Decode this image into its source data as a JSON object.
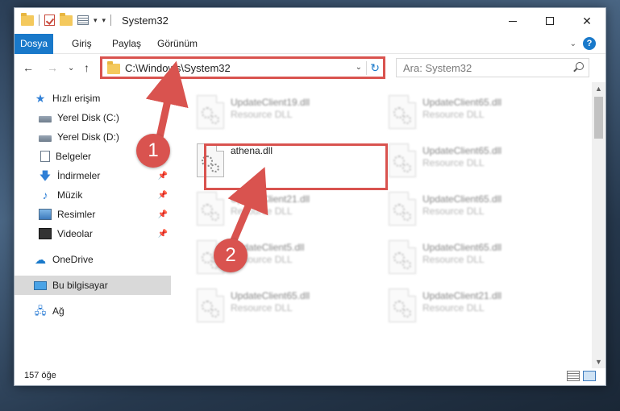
{
  "window": {
    "title": "System32"
  },
  "ribbon": {
    "tabs": [
      "Dosya",
      "Giriş",
      "Paylaş",
      "Görünüm"
    ]
  },
  "address": {
    "path": "C:\\Windows\\System32",
    "search_placeholder": "Ara: System32"
  },
  "sidebar": {
    "items": [
      {
        "label": "Hızlı erişim",
        "icon": "star-icon"
      },
      {
        "label": "Yerel Disk (C:)",
        "icon": "drive-icon"
      },
      {
        "label": "Yerel Disk (D:)",
        "icon": "drive-icon"
      },
      {
        "label": "Belgeler",
        "icon": "documents-icon"
      },
      {
        "label": "İndirmeler",
        "icon": "downloads-icon"
      },
      {
        "label": "Müzik",
        "icon": "music-icon"
      },
      {
        "label": "Resimler",
        "icon": "pictures-icon"
      },
      {
        "label": "Videolar",
        "icon": "videos-icon"
      },
      {
        "label": "OneDrive",
        "icon": "cloud-icon"
      },
      {
        "label": "Bu bilgisayar",
        "icon": "computer-icon"
      },
      {
        "label": "Ağ",
        "icon": "network-icon"
      }
    ]
  },
  "files": {
    "type_label": "Resource DLL",
    "items": [
      {
        "name": "UpdateClient19.dll",
        "blurred": true
      },
      {
        "name": "UpdateClient65.dll",
        "blurred": true
      },
      {
        "name": "athena.dll",
        "blurred": false
      },
      {
        "name": "UpdateClient65.dll",
        "blurred": true
      },
      {
        "name": "UpdateClient21.dll",
        "blurred": true
      },
      {
        "name": "UpdateClient65.dll",
        "blurred": true
      },
      {
        "name": "UpdateClient5.dll",
        "blurred": true
      },
      {
        "name": "UpdateClient65.dll",
        "blurred": true
      },
      {
        "name": "UpdateClient65.dll",
        "blurred": true
      },
      {
        "name": "UpdateClient21.dll",
        "blurred": true
      }
    ]
  },
  "status": {
    "count_text": "157 öğe"
  },
  "annotations": {
    "badge1": "1",
    "badge2": "2",
    "color": "#d9534f"
  }
}
